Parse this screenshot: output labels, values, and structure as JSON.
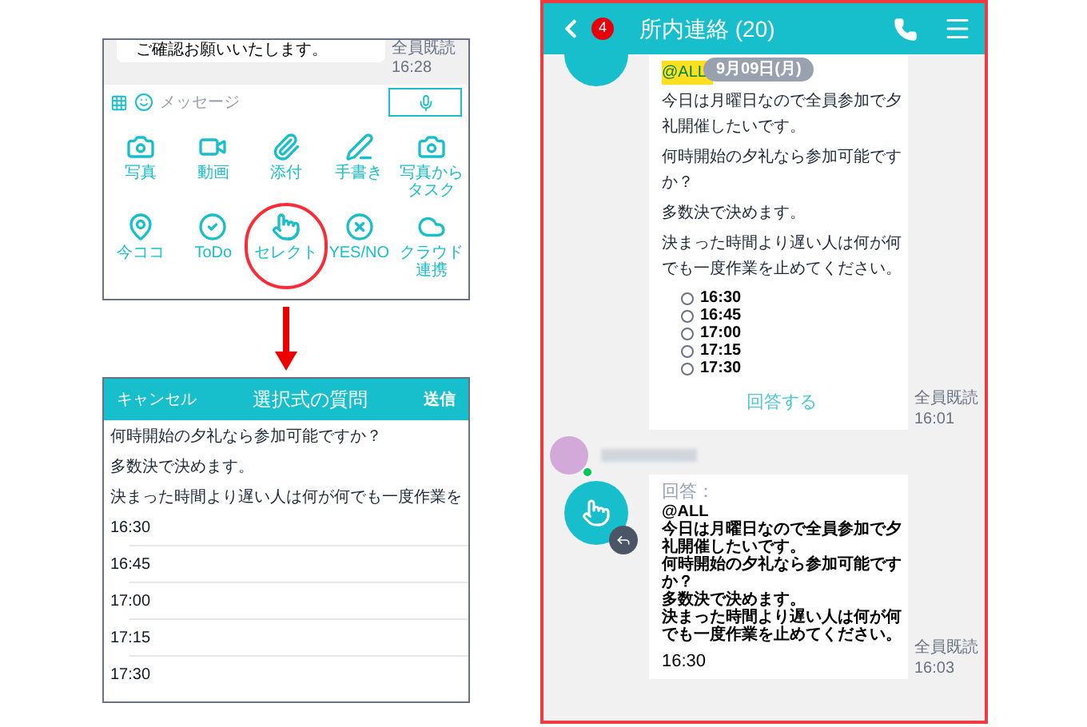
{
  "compose_screen": {
    "last_message": {
      "text": "ご確認お願いいたします。",
      "read_status": "全員既読",
      "time": "16:28"
    },
    "input": {
      "placeholder": "メッセージ"
    },
    "attachments": [
      {
        "label": "写真",
        "kind": "camera",
        "highlighted": false
      },
      {
        "label": "動画",
        "kind": "video",
        "highlighted": false
      },
      {
        "label": "添付",
        "kind": "clip",
        "highlighted": false
      },
      {
        "label": "手書き",
        "kind": "pen",
        "highlighted": false
      },
      {
        "label": "写真からタスク",
        "kind": "camera-task",
        "highlighted": false
      },
      {
        "label": "今ココ",
        "kind": "pin",
        "highlighted": false
      },
      {
        "label": "ToDo",
        "kind": "todo",
        "highlighted": false
      },
      {
        "label": "セレクト",
        "kind": "select",
        "highlighted": true
      },
      {
        "label": "YES/NO",
        "kind": "yesno",
        "highlighted": false
      },
      {
        "label": "クラウド連携",
        "kind": "cloud",
        "highlighted": false
      }
    ]
  },
  "question_screen": {
    "cancel": "キャンセル",
    "title": "選択式の質問",
    "send": "送信",
    "lines": [
      "何時開始の夕礼なら参加可能ですか？",
      "多数決で決めます。",
      "決まった時間より遅い人は何が何でも一度作業を"
    ],
    "options": [
      "16:30",
      "16:45",
      "17:00",
      "17:15",
      "17:30"
    ]
  },
  "chat": {
    "unread_badge": "4",
    "title": "所内連絡 (20)",
    "date": "9月09日(月)",
    "question_message": {
      "mention": "@ALL",
      "paragraphs": [
        "今日は月曜日なので全員参加で夕礼開催したいです。",
        "何時開始の夕礼なら参加可能ですか？",
        "多数決で決めます。",
        "決まった時間より遅い人は何が何でも一度作業を止めてください。"
      ],
      "options": [
        {
          "label": "16:30",
          "selected": false
        },
        {
          "label": "16:45",
          "selected": false
        },
        {
          "label": "17:00",
          "selected": false
        },
        {
          "label": "17:15",
          "selected": false
        },
        {
          "label": "17:30",
          "selected": false
        }
      ],
      "answer_button": "回答する",
      "read_status": "全員既読",
      "time": "16:01"
    },
    "reply_message": {
      "heading": "回答：",
      "lines": [
        "@ALL",
        "今日は月曜日なので全員参加で夕礼開催したいです。",
        "何時開始の夕礼なら参加可能ですか？",
        "多数決で決めます。",
        "決まった時間より遅い人は何が何でも一度作業を止めてください。"
      ],
      "answer": "16:30",
      "read_status": "全員既読",
      "time": "16:03"
    }
  }
}
